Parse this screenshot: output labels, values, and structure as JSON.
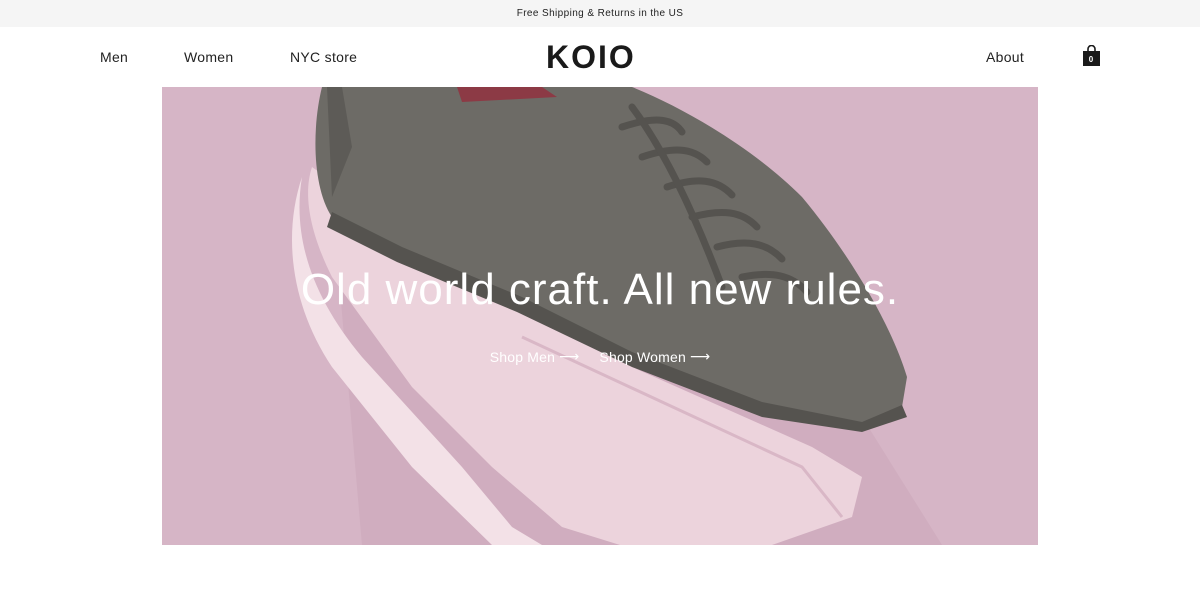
{
  "announcement": "Free Shipping & Returns in the US",
  "nav": {
    "men": "Men",
    "women": "Women",
    "store": "NYC store",
    "about": "About"
  },
  "logo": "KOIO",
  "cart": {
    "icon": "shopping-bag-icon",
    "count": "0"
  },
  "hero": {
    "image": "gray-leather-sneaker-over-pink-sneaker",
    "title": "Old world craft. All new rules.",
    "shop_men": "Shop Men",
    "shop_women": "Shop Women",
    "arrow": "⟶"
  },
  "colors": {
    "hero_background": "#d6b5c6",
    "text": "#1c1c1c",
    "announce_bg": "#f5f5f5"
  }
}
